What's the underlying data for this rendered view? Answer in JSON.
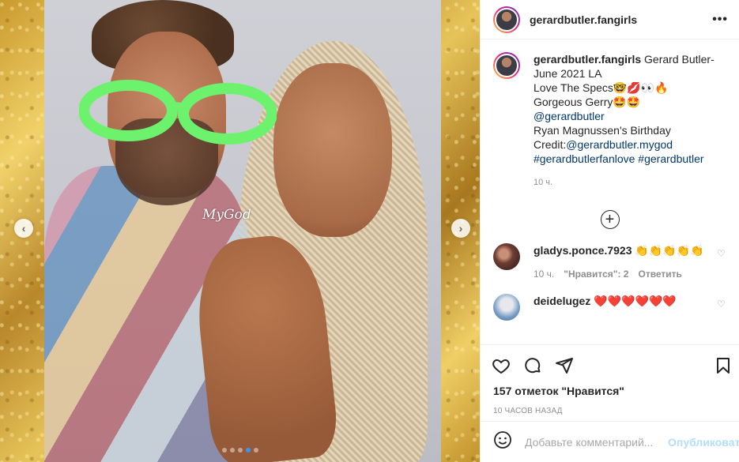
{
  "post": {
    "username": "gerardbutler.fangirls",
    "more": "•••",
    "media": {
      "watermark": "MyGod",
      "slide_count": 5,
      "active_slide": 4
    }
  },
  "caption": {
    "username": "gerardbutler.fangirls",
    "lines": [
      "Gerard Butler- June 2021 LA",
      "Love The Specs🤓💋👀🔥",
      "Gorgeous Gerry🤩🤩"
    ],
    "mention1": "@gerardbutler",
    "line_birthday": "Ryan Magnussen's Birthday",
    "credit_prefix": "Credit:",
    "credit_link": "@gerardbutler.mygod",
    "hashtags": "#gerardbutlerfanlove #gerardbutler",
    "time": "10 ч."
  },
  "comments": [
    {
      "username": "gladys.ponce.7923",
      "text": "👏👏👏👏👏",
      "time": "10 ч.",
      "likes": "\"Нравится\": 2",
      "reply": "Ответить"
    },
    {
      "username": "deidelugez",
      "text": "❤️❤️❤️❤️❤️❤️"
    }
  ],
  "likes_text": "157 отметок \"Нравится\"",
  "date_text": "10 ЧАСОВ НАЗАД",
  "add_comment": {
    "placeholder": "Добавьте комментарий...",
    "publish": "Опубликовать"
  },
  "colors": {
    "link": "#00376b",
    "publish_disabled": "#b2dffc",
    "active_dot": "#3897f0"
  }
}
